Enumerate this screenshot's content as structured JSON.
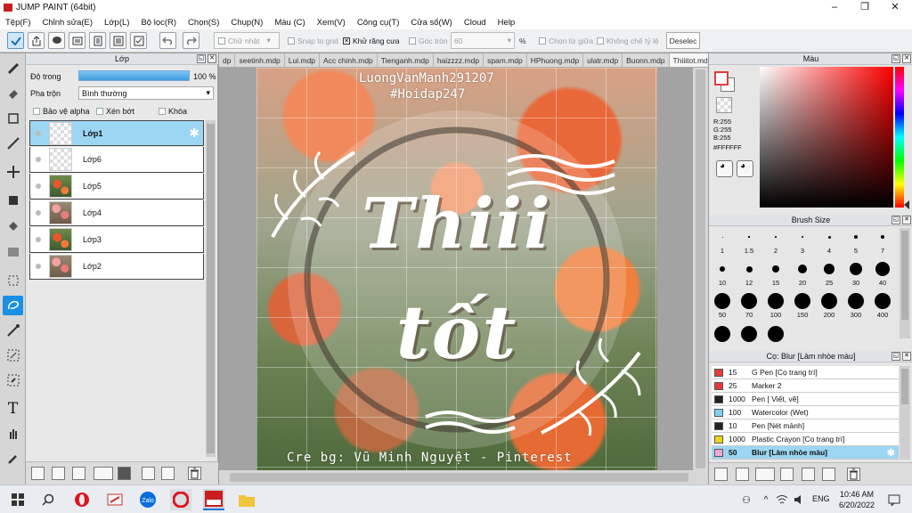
{
  "window": {
    "title": "JUMP PAINT (64bit)",
    "minimize": "–",
    "maximize": "❐",
    "close": "✕"
  },
  "menu": [
    "Tệp(F)",
    "Chỉnh sửa(E)",
    "Lớp(L)",
    "Bộ lọc(R)",
    "Chọn(S)",
    "Chụp(N)",
    "Màu (C)",
    "Xem(V)",
    "Công cụ(T)",
    "Cửa sổ(W)",
    "Cloud",
    "Help"
  ],
  "toolbar": {
    "shape": "Chữ nhật",
    "snap_to_grid": "Snap to grid",
    "antialias": "Khử răng cưa",
    "round_corner": "Góc tròn",
    "round_value": "60",
    "percent": "%",
    "select_center": "Chọn từ giữa",
    "constrain_ratio": "Không chế tỷ lệ",
    "deselect": "Deselec"
  },
  "layer_panel": {
    "title": "Lớp",
    "opacity_label": "Độ trong",
    "opacity_value": "100 %",
    "opacity": 1.0,
    "blend_label": "Pha trộn",
    "blend_value": "Bình thường",
    "protect_alpha": "Bảo vệ alpha",
    "clipping": "Xén bớt",
    "lock": "Khóa",
    "layers": [
      "Lớp1",
      "Lớp6",
      "Lớp5",
      "Lớp4",
      "Lớp3",
      "Lớp2"
    ]
  },
  "doc_tabs": [
    "dp",
    "seetinh.mdp",
    "Lui.mdp",
    "Acc chinh.mdp",
    "Tienganh.mdp",
    "haizzzz.mdp",
    "spam.mdp",
    "HPhuong.mdp",
    "ulatr.mdp",
    "Buonn.mdp",
    "Thiiitot.mdp"
  ],
  "artwork": {
    "watermark_top1": "LuongVanManh291207",
    "watermark_top2": "#Hoidap247",
    "big_line1": "Thiii",
    "big_line2": "tốt",
    "credit": "Cre bg: Vũ Minh Nguyệt - Pinterest"
  },
  "color_panel": {
    "title": "Màu",
    "r": "R:255",
    "g": "G:255",
    "b": "B:255",
    "hex": "#FFFFFF",
    "primary_color": "#ffffff",
    "accent_red": "#e53b3b"
  },
  "brush_size": {
    "title": "Brush Size",
    "sizes": [
      "1",
      "1.5",
      "2",
      "3",
      "4",
      "5",
      "7",
      "10",
      "12",
      "15",
      "20",
      "25",
      "30",
      "40",
      "50",
      "70",
      "100",
      "150",
      "200",
      "300",
      "400"
    ]
  },
  "brush_panel": {
    "title": "Cọ: Blur [Làm nhòe màu]",
    "brushes": [
      {
        "size": "15",
        "name": "G Pen [Cọ trang trí]",
        "color": "#e53b3b"
      },
      {
        "size": "25",
        "name": "Marker 2",
        "color": "#e53b3b"
      },
      {
        "size": "1000",
        "name": "Pen [ Viết, vẽ]",
        "color": "#222222"
      },
      {
        "size": "100",
        "name": "Watercolor (Wet)",
        "color": "#7fd2ef"
      },
      {
        "size": "10",
        "name": "Pen [Nét mảnh]",
        "color": "#222222"
      },
      {
        "size": "1000",
        "name": "Plastic Crayon [Cọ trang trí]",
        "color": "#f0d21b"
      },
      {
        "size": "50",
        "name": "Blur [Làm nhòe màu]",
        "color": "#f2a6d4"
      }
    ]
  },
  "taskbar": {
    "time": "10:46 AM",
    "date": "6/20/2022",
    "lang": "ENG"
  }
}
